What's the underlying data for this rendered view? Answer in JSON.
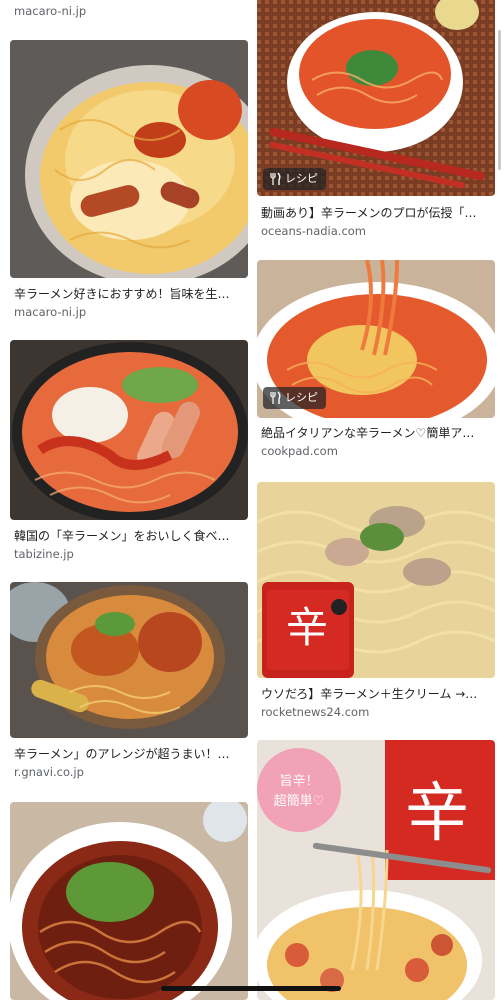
{
  "results": {
    "left": [
      {
        "title": "",
        "source": "macaro-ni.jp"
      },
      {
        "title": "辛ラーメン好きにおすすめ！旨味を生…",
        "source": "macaro-ni.jp"
      },
      {
        "title": "韓国の「辛ラーメン」をおいしく食べ…",
        "source": "tabizine.jp"
      },
      {
        "title": "辛ラーメン」のアレンジが超うまい！…",
        "source": "r.gnavi.co.jp"
      },
      {
        "title": "",
        "source": ""
      }
    ],
    "right": [
      {
        "title": "動画あり】辛ラーメンのプロが伝授「…",
        "source": "oceans-nadia.com",
        "badge": "レシピ"
      },
      {
        "title": "絶品イタリアンな辛ラーメン♡簡単ア…",
        "source": "cookpad.com",
        "badge": "レシピ"
      },
      {
        "title": "ウソだろ】辛ラーメン＋生クリーム →…",
        "source": "rocketnews24.com"
      },
      {
        "title": "",
        "source": "",
        "image_text": "旨辛！\n超簡単♡"
      }
    ]
  },
  "package_text": "辛",
  "colors": {
    "text": "#202124",
    "source": "#5f6368",
    "badge_bg": "#202124",
    "noodle_soup": "#e2552a"
  }
}
